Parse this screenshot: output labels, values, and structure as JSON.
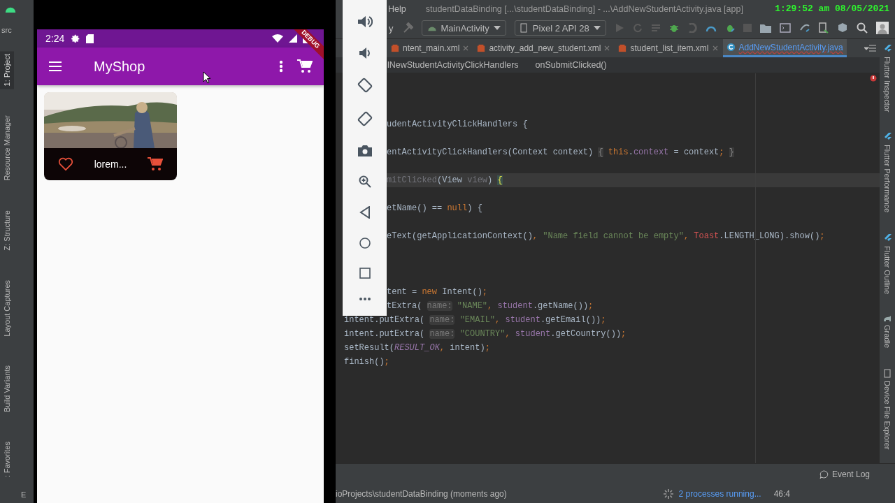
{
  "left_strip": {
    "path_label": "src",
    "tool_tabs": [
      {
        "label": "1: Project",
        "selected": true
      },
      {
        "label": "Resource Manager",
        "selected": false
      },
      {
        "label": "Z: Structure",
        "selected": false
      },
      {
        "label": "Layout Captures",
        "selected": false
      },
      {
        "label": "Build Variants",
        "selected": false
      },
      {
        "label": ": Favorites",
        "selected": false
      }
    ],
    "bottom_label": "E"
  },
  "phone": {
    "status_time": "2:24",
    "debug_banner": "DEBUG",
    "app_title": "MyShop",
    "products": [
      {
        "title": "lorem...",
        "favorite": false
      }
    ]
  },
  "ide": {
    "menu_item": "Help",
    "window_title": "studentDataBinding [...\\studentDataBinding] - ...\\AddNewStudentActivity.java [app]",
    "clock": "1:29:52 am 08/05/2021",
    "toolbar_fragment": "y",
    "run_config": "MainActivity",
    "device": "Pixel 2 API 28",
    "tabs": [
      {
        "label": "ntent_main.xml",
        "kind": "xml",
        "selected": false
      },
      {
        "label": "activity_add_new_student.xml",
        "kind": "xml",
        "selected": false
      },
      {
        "label": "student_list_item.xml",
        "kind": "xml",
        "selected": false
      },
      {
        "label": "AddNewStudentActivity.java",
        "kind": "java",
        "selected": true
      }
    ],
    "breadcrumbs": [
      "lNewStudentActivityClickHandlers",
      "onSubmitClicked()"
    ],
    "code_lines": [
      {
        "clipped": true,
        "current": false,
        "tokens": [
          {
            "text": "udentActivityClickHandlers {",
            "kind": "plain"
          }
        ]
      },
      {
        "clipped": true,
        "current": false,
        "tokens": [
          {
            "text": "entActivityClickHandlers(Context context) ",
            "kind": "plain"
          },
          {
            "text": "{",
            "kind": "fold"
          },
          {
            "text": " this",
            "kind": "keyword"
          },
          {
            "text": ".",
            "kind": "plain"
          },
          {
            "text": "context",
            "kind": "field"
          },
          {
            "text": " = context",
            "kind": "plain"
          },
          {
            "text": "; ",
            "kind": "keyword"
          },
          {
            "text": "}",
            "kind": "fold"
          }
        ]
      },
      {
        "clipped": true,
        "current": true,
        "tokens": [
          {
            "text": "mitClicked",
            "kind": "unused"
          },
          {
            "text": "(View ",
            "kind": "plain"
          },
          {
            "text": "view",
            "kind": "unused"
          },
          {
            "text": ") ",
            "kind": "plain"
          },
          {
            "text": "{",
            "kind": "brace"
          }
        ]
      },
      {
        "clipped": true,
        "current": false,
        "tokens": [
          {
            "text": "etName() == ",
            "kind": "plain"
          },
          {
            "text": "null",
            "kind": "keyword"
          },
          {
            "text": ") {",
            "kind": "plain"
          }
        ]
      },
      {
        "clipped": true,
        "current": false,
        "tokens": [
          {
            "text": "eText(getApplicationContext()",
            "kind": "plain"
          },
          {
            "text": ", ",
            "kind": "keyword"
          },
          {
            "text": "\"Name field cannot be empty\"",
            "kind": "string"
          },
          {
            "text": ", ",
            "kind": "keyword"
          },
          {
            "text": "Toast",
            "kind": "error"
          },
          {
            "text": ".LENGTH_LONG).show()",
            "kind": "plain"
          },
          {
            "text": ";",
            "kind": "keyword"
          }
        ]
      },
      {
        "clipped": true,
        "current": false,
        "tokens": [
          {
            "text": "tent = ",
            "kind": "plain"
          },
          {
            "text": "new",
            "kind": "keyword"
          },
          {
            "text": " Intent()",
            "kind": "plain"
          },
          {
            "text": ";",
            "kind": "keyword"
          }
        ]
      },
      {
        "clipped": true,
        "current": false,
        "tokens": [
          {
            "text": "tExtra( ",
            "kind": "plain"
          },
          {
            "text": "name:",
            "kind": "hint"
          },
          {
            "text": " \"NAME\"",
            "kind": "string"
          },
          {
            "text": ", ",
            "kind": "keyword"
          },
          {
            "text": "student",
            "kind": "field"
          },
          {
            "text": ".getName())",
            "kind": "plain"
          },
          {
            "text": ";",
            "kind": "keyword"
          }
        ]
      },
      {
        "clipped": false,
        "current": false,
        "tokens": [
          {
            "text": "intent.putExtra( ",
            "kind": "plain"
          },
          {
            "text": "name:",
            "kind": "hint"
          },
          {
            "text": " \"EMAIL\"",
            "kind": "string"
          },
          {
            "text": ", ",
            "kind": "keyword"
          },
          {
            "text": "student",
            "kind": "field"
          },
          {
            "text": ".getEmail())",
            "kind": "plain"
          },
          {
            "text": ";",
            "kind": "keyword"
          }
        ]
      },
      {
        "clipped": false,
        "current": false,
        "tokens": [
          {
            "text": "intent.putExtra( ",
            "kind": "plain"
          },
          {
            "text": "name:",
            "kind": "hint"
          },
          {
            "text": " \"COUNTRY\"",
            "kind": "string"
          },
          {
            "text": ", ",
            "kind": "keyword"
          },
          {
            "text": "student",
            "kind": "field"
          },
          {
            "text": ".getCountry())",
            "kind": "plain"
          },
          {
            "text": ";",
            "kind": "keyword"
          }
        ]
      },
      {
        "clipped": false,
        "current": false,
        "tokens": [
          {
            "text": "setResult(",
            "kind": "plain"
          },
          {
            "text": "RESULT_OK",
            "kind": "constant"
          },
          {
            "text": ", ",
            "kind": "keyword"
          },
          {
            "text": "intent)",
            "kind": "plain"
          },
          {
            "text": ";",
            "kind": "keyword"
          }
        ]
      },
      {
        "clipped": false,
        "current": false,
        "tokens": [
          {
            "text": "finish()",
            "kind": "plain"
          },
          {
            "text": ";",
            "kind": "keyword"
          }
        ]
      }
    ],
    "right_tool_tabs": [
      {
        "label": "Flutter Inspector",
        "kind": "flutter"
      },
      {
        "label": "Flutter Performance",
        "kind": "flutter"
      },
      {
        "label": "Flutter Outline",
        "kind": "flutter"
      },
      {
        "label": "Gradle",
        "kind": "gradle"
      },
      {
        "label": "Device File Explorer",
        "kind": "device"
      }
    ],
    "event_log": "Event Log",
    "status": {
      "path": "ioProjects\\studentDataBinding (moments ago)",
      "processes": "2 processes running...",
      "position": "46:4"
    }
  }
}
